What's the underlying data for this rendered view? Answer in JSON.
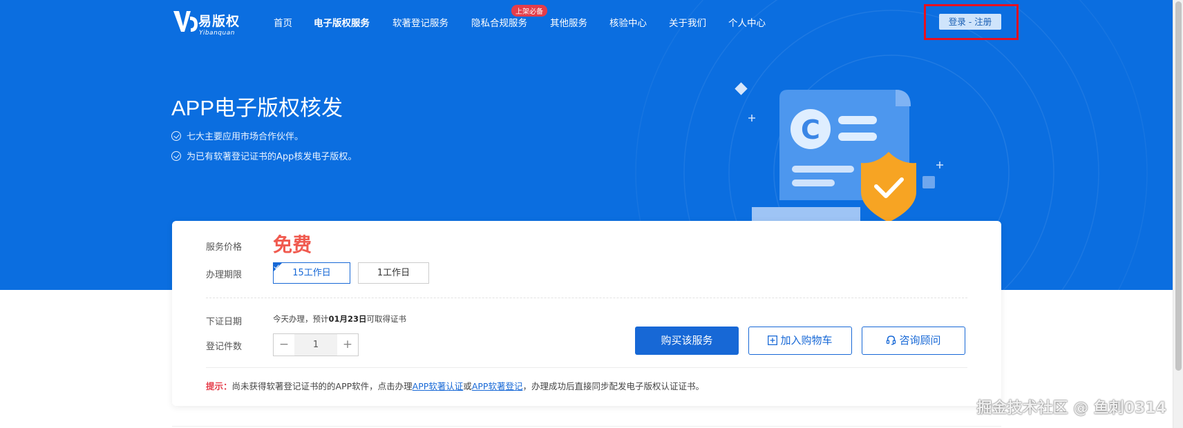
{
  "brand": {
    "name_cn": "易版权",
    "name_en": "Yibanquan"
  },
  "nav": {
    "items": [
      {
        "label": "首页"
      },
      {
        "label": "电子版权服务"
      },
      {
        "label": "软著登记服务"
      },
      {
        "label": "隐私合规服务"
      },
      {
        "label": "其他服务"
      },
      {
        "label": "核验中心"
      },
      {
        "label": "关于我们"
      },
      {
        "label": "个人中心"
      }
    ],
    "active_index": 1,
    "badge": "上架必备",
    "login_label": "登录 - 注册"
  },
  "hero": {
    "title": "APP电子版权核发",
    "points": [
      "七大主要应用市场合作伙伴。",
      "为已有软著登记证书的App核发电子版权。"
    ]
  },
  "card": {
    "price_label": "服务价格",
    "price_value": "免费",
    "period_label": "办理期限",
    "period_options": [
      {
        "label": "15工作日",
        "selected": true
      },
      {
        "label": "1工作日",
        "selected": false
      }
    ],
    "date_label": "下证日期",
    "date_prefix": "今天办理，预计",
    "date_value": "01月23日",
    "date_suffix": "可取得证书",
    "count_label": "登记件数",
    "count_value": "1",
    "buy_label": "购买该服务",
    "cart_label": "加入购物车",
    "consult_label": "咨询顾问",
    "tip": {
      "label": "提示：",
      "text1": "尚未获得软著登记证书的的APP软件，点击办理",
      "link1": "APP软著认证",
      "text2": "或",
      "link2": "APP软著登记",
      "text3": "，办理成功后直接同步配发电子版权认证证书。"
    }
  },
  "watermark": "掘金技术社区 @ 鱼刺0314",
  "colors": {
    "hero_bg": "#0b6ee0",
    "primary": "#1768d6",
    "price": "#f05a4f",
    "highlight_box": "#e8101f",
    "badge": "#e53d4a"
  }
}
